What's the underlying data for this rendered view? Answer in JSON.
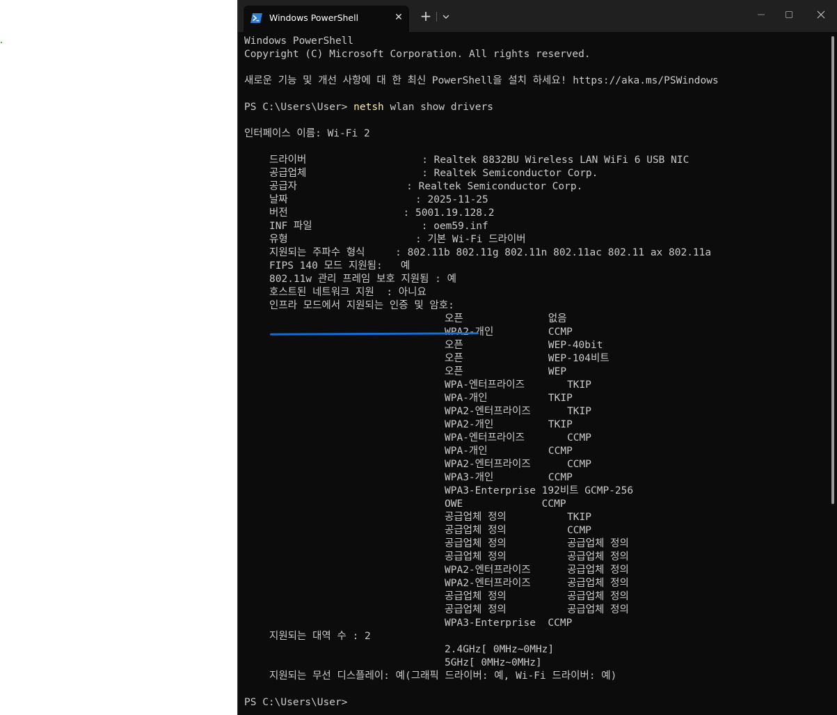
{
  "window": {
    "title": "Windows PowerShell",
    "tab_close": "✕",
    "new_tab": "+"
  },
  "terminal": {
    "header1": "Windows PowerShell",
    "header2": "Copyright (C) Microsoft Corporation. All rights reserved.",
    "notice": "새로운 기능 및 개선 사항에 대 한 최신 PowerShell을 설치 하세요! https://aka.ms/PSWindows",
    "prompt1": "PS C:\\Users\\User> ",
    "command": "netsh",
    "command_args": " wlan show drivers",
    "interface": "인터페이스 이름: Wi-Fi 2",
    "driver_info": [
      "드라이버                   : Realtek 8832BU Wireless LAN WiFi 6 USB NIC",
      "공급업체                   : Realtek Semiconductor Corp.",
      "공급자                  : Realtek Semiconductor Corp.",
      "날짜                     : 2025-11-25",
      "버전                   : 5001.19.128.2",
      "INF 파일                  : oem59.inf",
      "유형                     : 기본 Wi-Fi 드라이버",
      "지원되는 주파수 형식     : 802.11b 802.11g 802.11n 802.11ac 802.11 ax 802.11a",
      "FIPS 140 모드 지원됨:   예",
      "802.11w 관리 프레임 보호 지원됨 : 예",
      "호스트된 네트워크 지원  : 아니요",
      "인프라 모드에서 지원되는 인증 및 암호:"
    ],
    "auth_ciphers": [
      "오픈              없음",
      "WPA2-개인         CCMP",
      "오픈              WEP-40bit",
      "오픈              WEP-104비트",
      "오픈              WEP",
      "WPA-엔터프라이즈       TKIP",
      "WPA-개인          TKIP",
      "WPA2-엔터프라이즈      TKIP",
      "WPA2-개인         TKIP",
      "WPA-엔터프라이즈       CCMP",
      "WPA-개인          CCMP",
      "WPA2-엔터프라이즈      CCMP",
      "WPA3-개인         CCMP",
      "WPA3-Enterprise 192비트 GCMP-256",
      "OWE             CCMP",
      "공급업체 정의          TKIP",
      "공급업체 정의          CCMP",
      "공급업체 정의          공급업체 정의",
      "공급업체 정의          공급업체 정의",
      "WPA2-엔터프라이즈      공급업체 정의",
      "WPA2-엔터프라이즈      공급업체 정의",
      "공급업체 정의          공급업체 정의",
      "공급업체 정의          공급업체 정의",
      "WPA3-Enterprise  CCMP"
    ],
    "bands_label": "지원되는 대역 수 : 2",
    "bands": [
      "2.4GHz[ 0MHz~0MHz]",
      "5GHz[ 0MHz~0MHz]"
    ],
    "wireless_display": "지원되는 무선 디스플레이: 예(그래픽 드라이버: 예, Wi-Fi 드라이버: 예)",
    "prompt2": "PS C:\\Users\\User>"
  },
  "colors": {
    "terminal_bg": "#0c0c0c",
    "terminal_text": "#cccccc",
    "command_text": "#f9f1a5",
    "underline_annotation": "#0f6fd9"
  }
}
